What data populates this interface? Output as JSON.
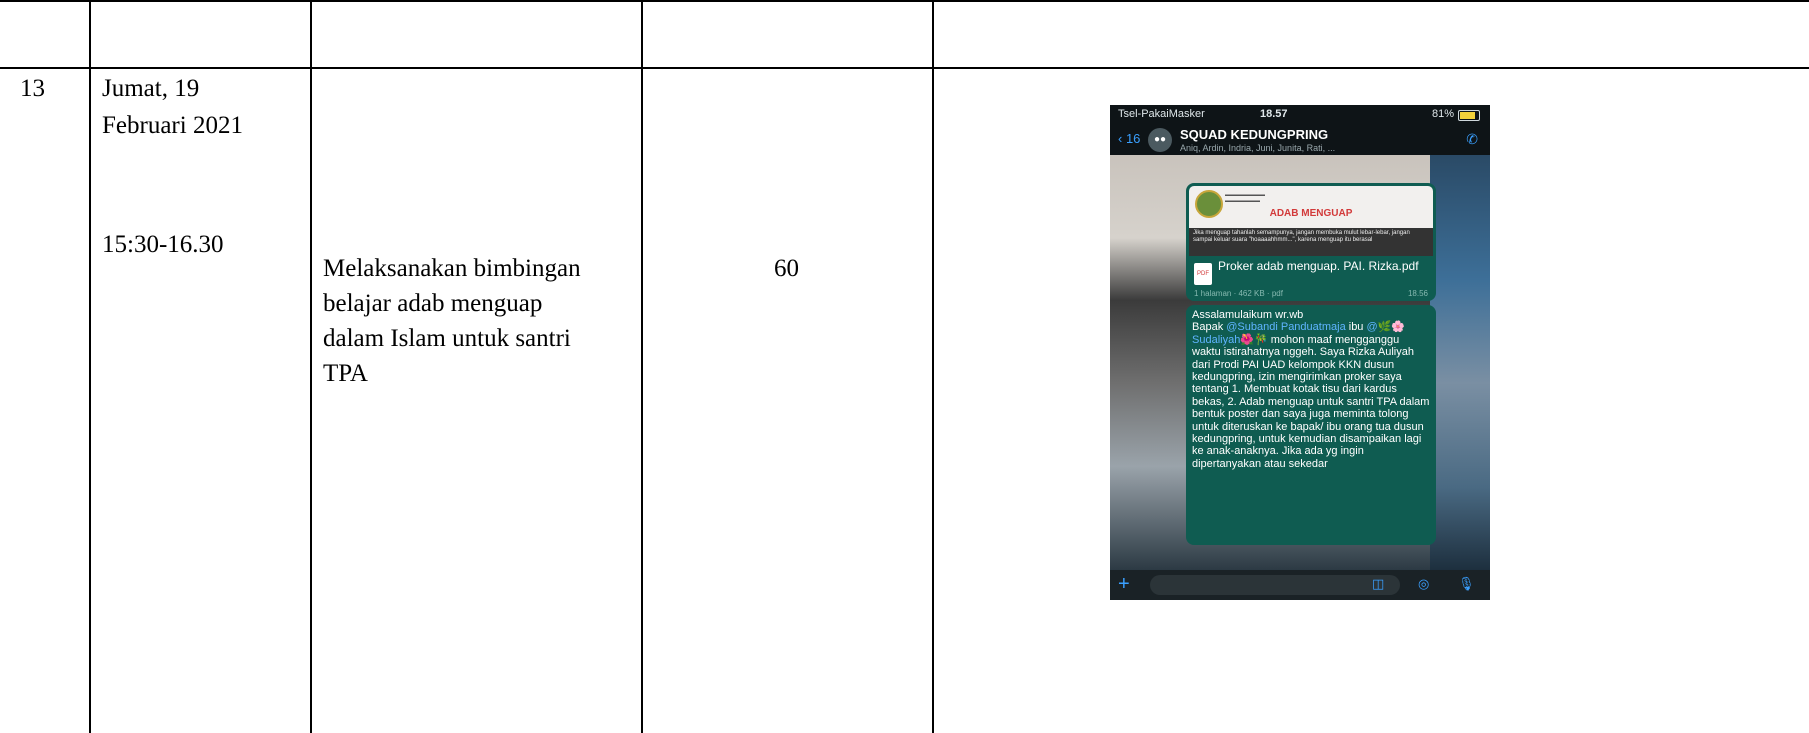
{
  "row": {
    "number": "13",
    "date_line1": "Jumat, 19",
    "date_line2": "Februari 2021",
    "time": "15:30-16.30",
    "activity_lines": [
      "Melaksanakan bimbingan",
      "belajar adab menguap",
      "dalam Islam untuk santri",
      "TPA"
    ],
    "duration": "60"
  },
  "phone": {
    "status": {
      "carrier": "Tsel-PakaiMasker",
      "time": "18.57",
      "battery": "81%"
    },
    "header": {
      "back_count": "16",
      "group_name": "SQUAD KEDUNGPRING",
      "members": "Aniq, Ardin, Indria, Juni, Junita, Rati, ..."
    },
    "poster": {
      "title": "ADAB MENGUAP",
      "body": "Jika menguap tahanlah semampunya, jangan membuka mulut lebar-lebar, jangan sampai keluar suara \"hoaaaahhmm...\", karena menguap itu berasal"
    },
    "file": {
      "name": "Proker adab menguap. PAI. Rizka.pdf",
      "meta": "1 halaman · 462 KB · pdf",
      "time": "18.56"
    },
    "message": {
      "greeting": "Assalamulaikum wr.wb",
      "bapak": "Bapak",
      "mention1": "@Subandi Panduatmaja",
      "ibu": "ibu",
      "mention2": "@🌿🌸 Sudaliyah🌺🎋",
      "body": "mohon maaf mengganggu waktu istirahatnya nggeh. Saya Rizka Auliyah dari Prodi PAI UAD kelompok KKN dusun kedungpring, izin mengirimkan proker saya tentang 1. Membuat kotak tisu dari kardus bekas, 2. Adab menguap untuk santri TPA dalam bentuk poster dan saya juga meminta tolong untuk diteruskan ke bapak/ ibu  orang tua dusun kedungpring, untuk kemudian disampaikan lagi ke anak-anaknya. Jika ada yg ingin dipertanyakan atau sekedar"
    }
  }
}
